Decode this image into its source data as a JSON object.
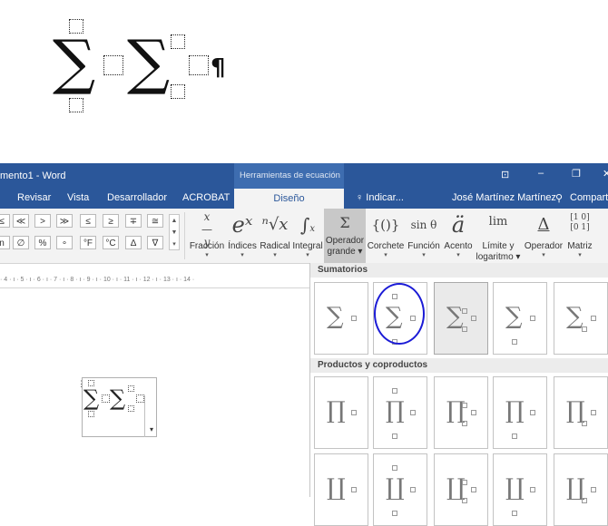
{
  "equation_zoom": {
    "pilcrow": "¶"
  },
  "titlebar": {
    "doc_title": "mento1 - Word",
    "context_tab": "Herramientas de ecuación",
    "window_buttons": [
      "⊡",
      "–",
      "❐",
      "✕"
    ]
  },
  "tabs": {
    "items": [
      "Revisar",
      "Vista",
      "Desarrollador",
      "ACROBAT"
    ],
    "active": "Diseño",
    "tell_me": "♀ Indicar...",
    "user": "José Martínez Martínez",
    "share": "Compartir"
  },
  "symbols": {
    "row1": [
      "≤",
      "≪",
      ">",
      "≫",
      "≤",
      "≥",
      "∓",
      "≅"
    ],
    "row2": [
      "n",
      "∅",
      "%",
      "∘",
      "°F",
      "°C",
      "∆",
      "∇"
    ]
  },
  "ribbon_buttons": [
    {
      "icon": "x/y",
      "label": "Fracción"
    },
    {
      "icon": "eˣ",
      "label": "Índices"
    },
    {
      "icon": "ⁿ√x",
      "label": "Radical"
    },
    {
      "icon": "∫",
      "label": "Integral"
    },
    {
      "icon": "Σ",
      "label": "Operador",
      "label2": "grande"
    },
    {
      "icon": "{()}",
      "label": "Corchete"
    },
    {
      "icon": "sin θ",
      "label": "Función"
    },
    {
      "icon": "ä",
      "label": "Acento"
    },
    {
      "icon": "lim",
      "label": "Límite y",
      "label2": "logaritmo"
    },
    {
      "icon": "Δ",
      "label": "Operador"
    },
    {
      "icon": "[10 01]",
      "label": "Matriz"
    }
  ],
  "ruler": {
    "text": "· 4 · ı · 5 · ı · 6 · ı · 7 · ı · 8 · ı · 9 · ı · 10 · ı · 11 · ı · 12 · ı · 13 · ı · 14 ·"
  },
  "dropdown": {
    "section1": "Sumatorios",
    "section2": "Productos y coproductos",
    "selected_index": 2
  },
  "accent_colors": {
    "ribbon_blue": "#2b579a",
    "annotation_circle": "#1b1bd6"
  }
}
